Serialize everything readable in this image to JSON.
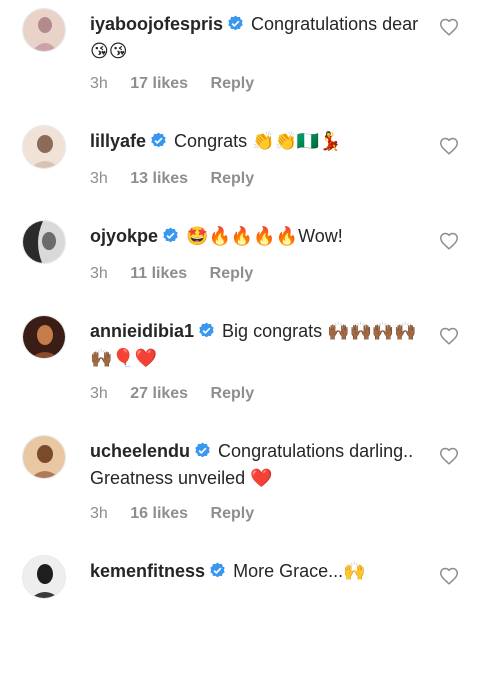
{
  "comments": [
    {
      "username": "iyaboojofespris",
      "text": "Congratulations dear 😘😘",
      "time": "3h",
      "likes": "17 likes",
      "reply": "Reply",
      "avatar_colors": [
        "#e9d3c9",
        "#b38b8f"
      ]
    },
    {
      "username": "lillyafe",
      "text": "Congrats 👏👏🇳🇬💃",
      "time": "3h",
      "likes": "13 likes",
      "reply": "Reply",
      "avatar_colors": [
        "#f0e2d6",
        "#8c6b58"
      ]
    },
    {
      "username": "ojyokpe",
      "text": "🤩🔥🔥🔥🔥Wow!",
      "time": "3h",
      "likes": "11 likes",
      "reply": "Reply",
      "avatar_colors": [
        "#d9d9d9",
        "#2b2b2b"
      ]
    },
    {
      "username": "annieidibia1",
      "text": "Big congrats 🙌🏾🙌🏾🙌🏾🙌🏾🙌🏾🎈❤️",
      "time": "3h",
      "likes": "27 likes",
      "reply": "Reply",
      "avatar_colors": [
        "#c67b4a",
        "#3a1d14"
      ]
    },
    {
      "username": "ucheelendu",
      "text": "Congratulations darling.. Greatness unveiled ❤️",
      "time": "3h",
      "likes": "16 likes",
      "reply": "Reply",
      "avatar_colors": [
        "#e8c7a2",
        "#7a4a2d"
      ]
    },
    {
      "username": "kemenfitness",
      "text": "More Grace...🙌",
      "avatar_colors": [
        "#eeeeee",
        "#1e1e1e"
      ]
    }
  ],
  "colors": {
    "text": "#262626",
    "meta": "#8e8e8e",
    "verified": "#3897f0"
  },
  "icons": {
    "verified": "verified-badge-icon",
    "like": "heart-outline-icon"
  }
}
